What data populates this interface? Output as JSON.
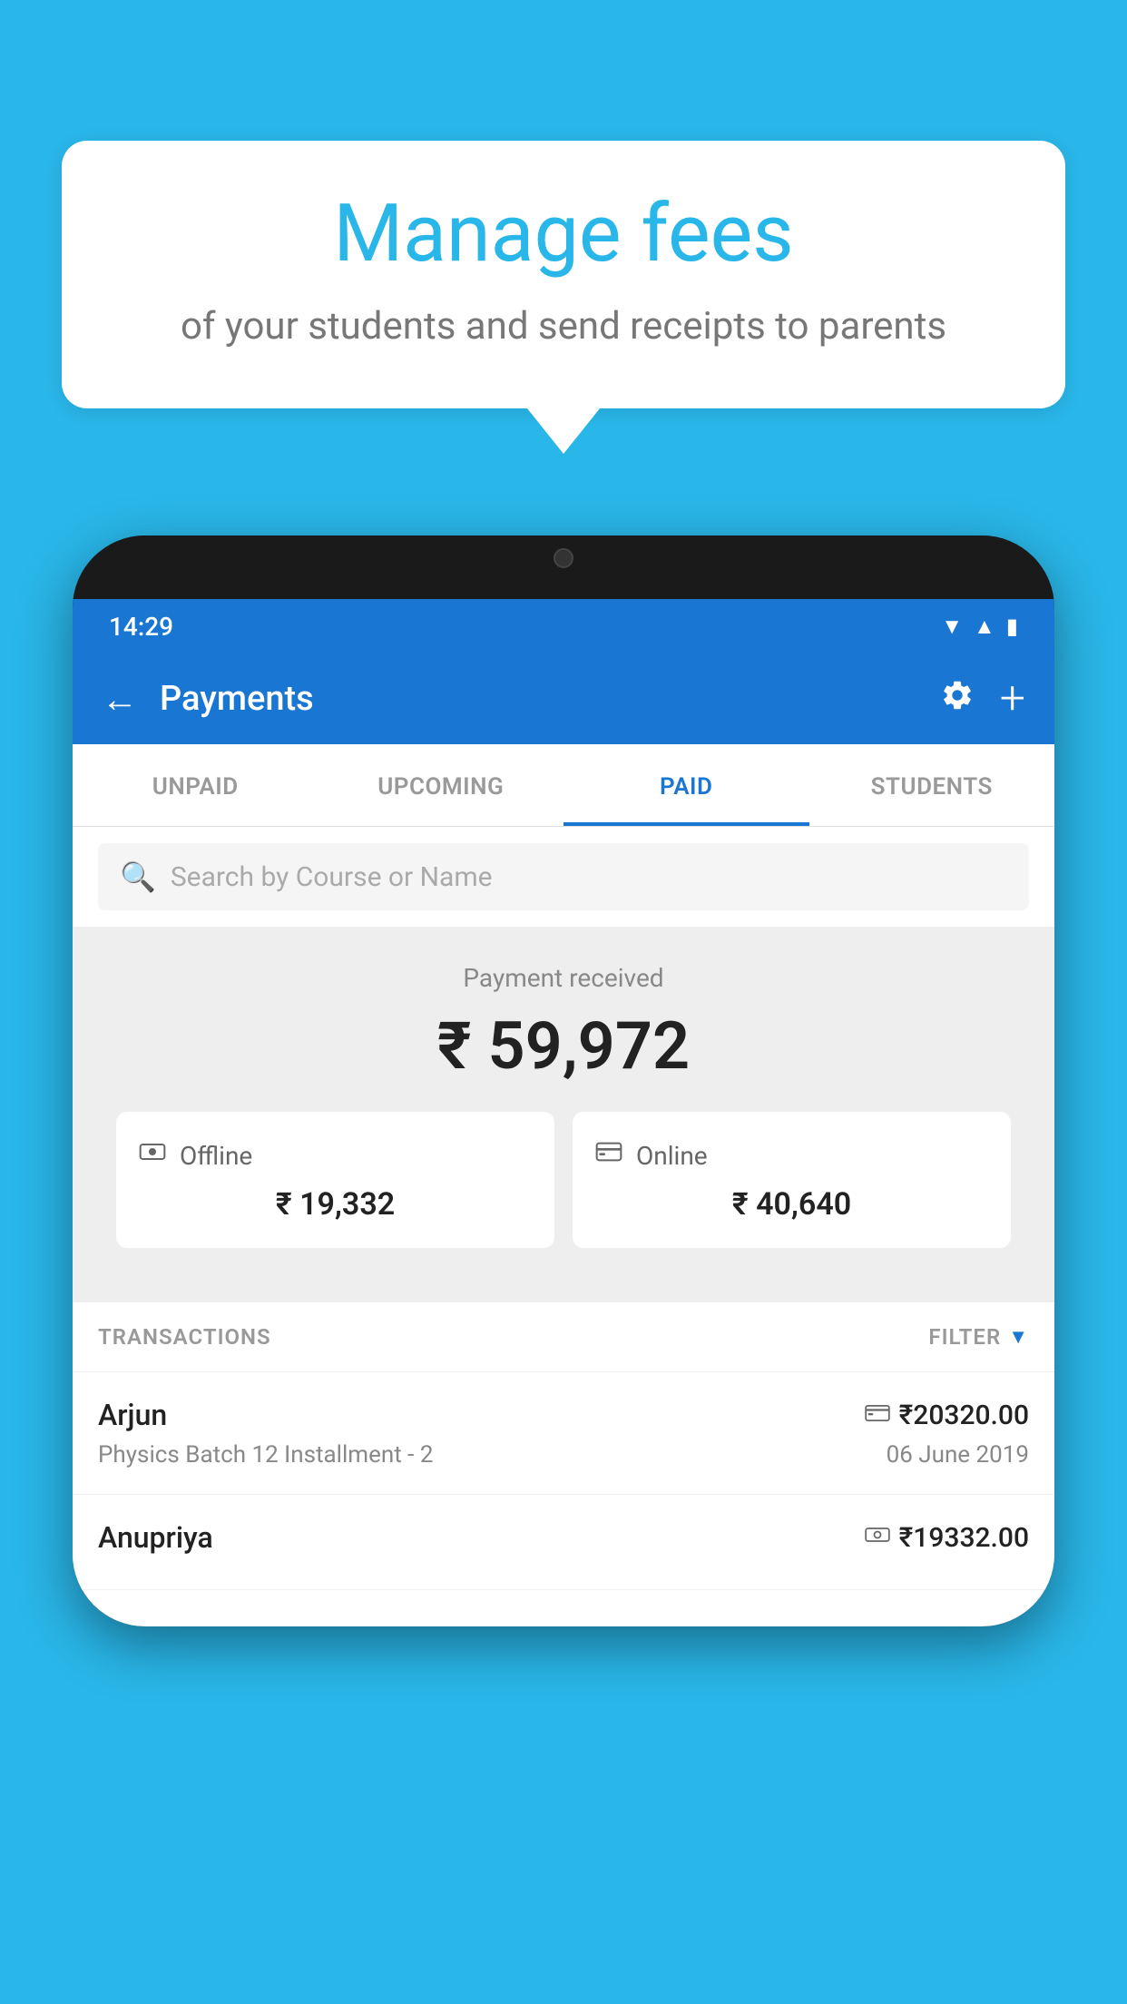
{
  "background_color": "#29b6e8",
  "bubble": {
    "title": "Manage fees",
    "subtitle": "of your students and send receipts to parents"
  },
  "status_bar": {
    "time": "14:29",
    "icons": [
      "wifi",
      "signal",
      "battery"
    ]
  },
  "app_bar": {
    "title": "Payments",
    "back_label": "←",
    "settings_label": "⚙",
    "add_label": "+"
  },
  "tabs": [
    {
      "label": "UNPAID",
      "active": false
    },
    {
      "label": "UPCOMING",
      "active": false
    },
    {
      "label": "PAID",
      "active": true
    },
    {
      "label": "STUDENTS",
      "active": false
    }
  ],
  "search": {
    "placeholder": "Search by Course or Name"
  },
  "payment_received": {
    "label": "Payment received",
    "amount": "₹ 59,972"
  },
  "payment_cards": [
    {
      "icon": "offline",
      "label": "Offline",
      "amount": "₹ 19,332"
    },
    {
      "icon": "online",
      "label": "Online",
      "amount": "₹ 40,640"
    }
  ],
  "transactions": {
    "label": "TRANSACTIONS",
    "filter_label": "FILTER"
  },
  "transaction_rows": [
    {
      "name": "Arjun",
      "course": "Physics Batch 12 Installment - 2",
      "amount": "₹20320.00",
      "date": "06 June 2019",
      "mode": "online"
    },
    {
      "name": "Anupriya",
      "course": "",
      "amount": "₹19332.00",
      "date": "",
      "mode": "offline"
    }
  ]
}
